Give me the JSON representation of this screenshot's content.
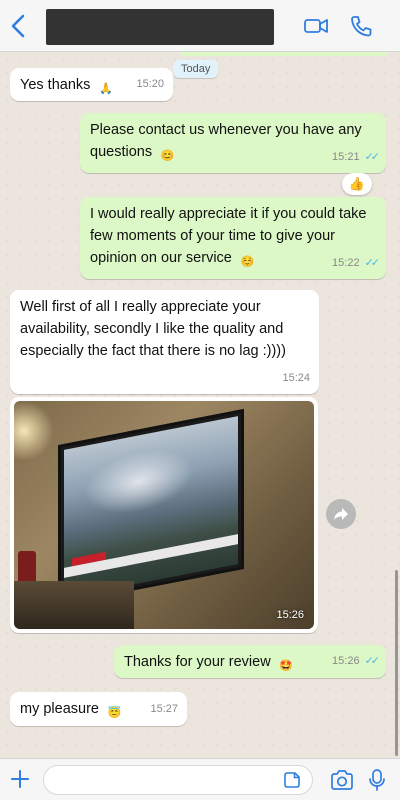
{
  "header": {
    "back_icon": "chevron-left-icon",
    "video_icon": "video-camera-icon",
    "phone_icon": "phone-icon",
    "accent": "#2f7de1"
  },
  "chat": {
    "date_chip": "Today",
    "messages": [
      {
        "dir": "in",
        "text": "Yes thanks",
        "emoji": "🙏",
        "time": "15:20"
      },
      {
        "dir": "out",
        "text": "Please contact us whenever you have any questions",
        "emoji": "😊",
        "time": "15:21",
        "reaction": "👍"
      },
      {
        "dir": "out",
        "text": "I would really appreciate it if you could take few moments of your time to give your opinion on our service",
        "emoji": "☺️",
        "time": "15:22"
      },
      {
        "dir": "in",
        "text": "Well first of all I really appreciate your availability, secondly I like the quality and especially the fact that there is no lag :))))",
        "time": "15:24"
      },
      {
        "dir": "in",
        "type": "photo",
        "time": "15:26"
      },
      {
        "dir": "out",
        "text": "Thanks for your review",
        "emoji": "🤩",
        "time": "15:26"
      },
      {
        "dir": "in",
        "text": "my pleasure",
        "emoji": "😇",
        "time": "15:27"
      }
    ]
  },
  "input_bar": {
    "value": "",
    "plus_icon": "plus-icon",
    "sticker_icon": "sticker-icon",
    "camera_icon": "camera-icon",
    "mic_icon": "microphone-icon"
  },
  "colors": {
    "outgoing_bubble": "#dcf8c6",
    "incoming_bubble": "#ffffff",
    "chat_background": "#ece5dd",
    "read_ticks": "#4fb6ec"
  }
}
